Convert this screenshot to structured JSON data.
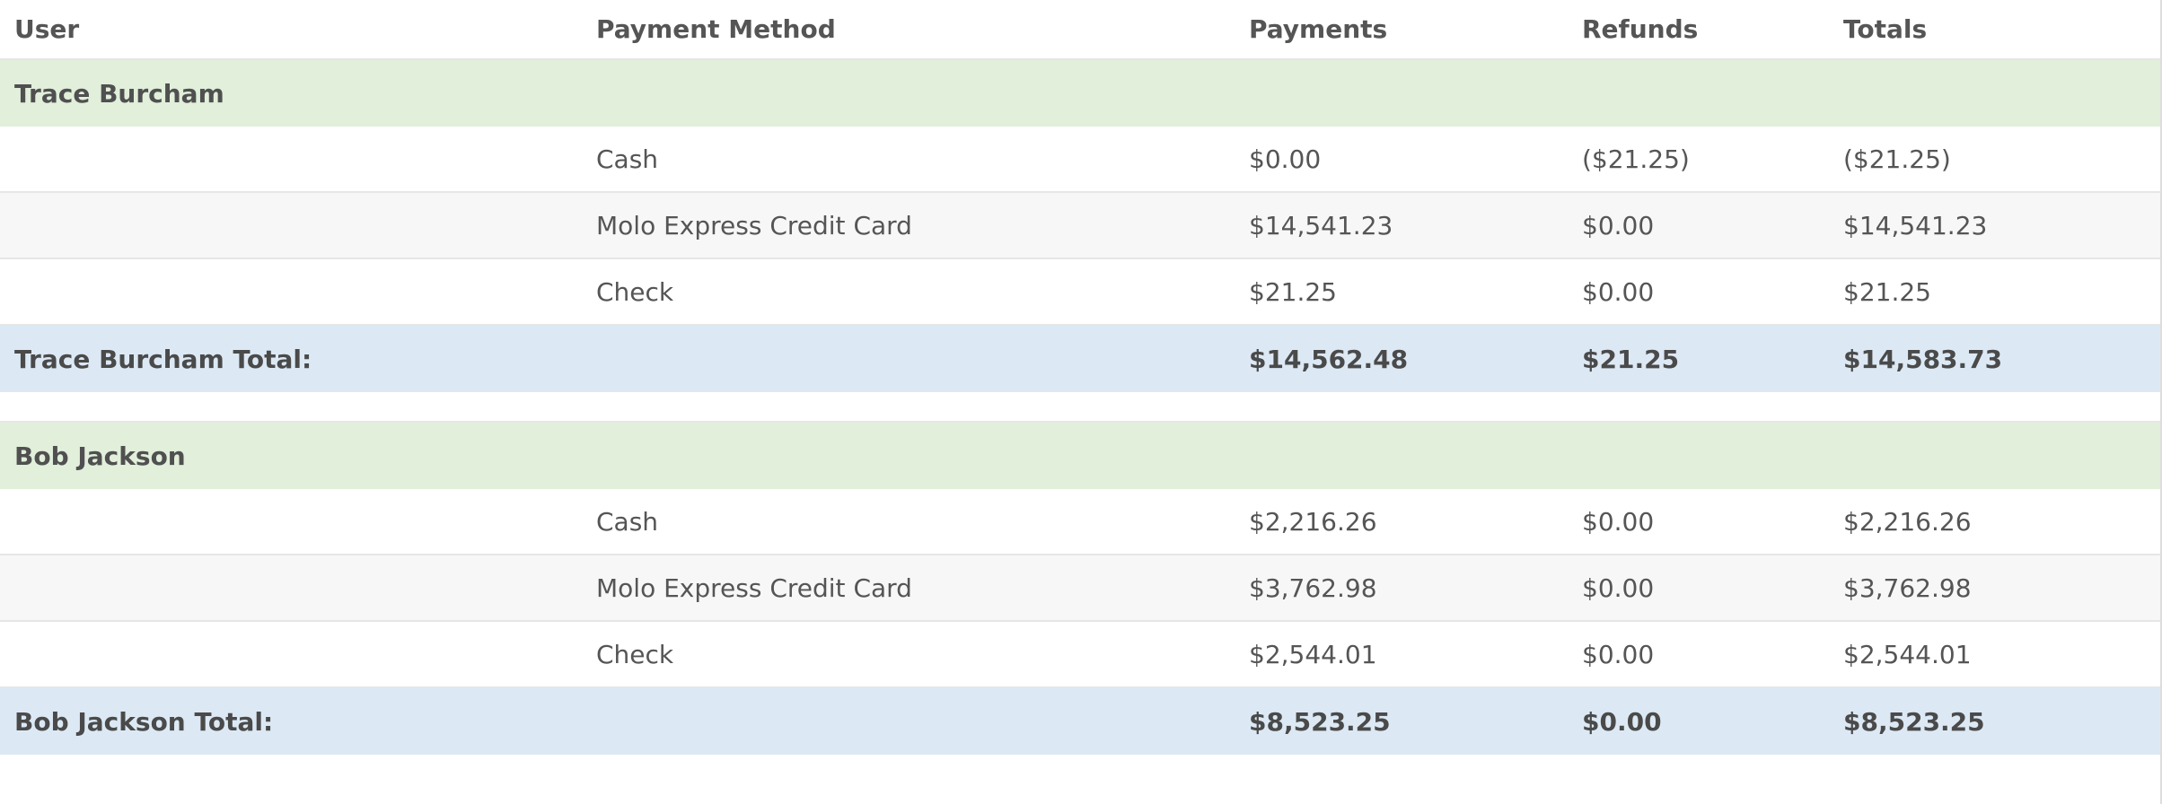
{
  "table": {
    "headers": {
      "user": "User",
      "payment_method": "Payment Method",
      "payments": "Payments",
      "refunds": "Refunds",
      "totals": "Totals"
    },
    "groups": [
      {
        "user": "Trace Burcham",
        "rows": [
          {
            "method": "Cash",
            "payments": "$0.00",
            "refunds": "($21.25)",
            "totals": "($21.25)"
          },
          {
            "method": "Molo Express Credit Card",
            "payments": "$14,541.23",
            "refunds": "$0.00",
            "totals": "$14,541.23"
          },
          {
            "method": "Check",
            "payments": "$21.25",
            "refunds": "$0.00",
            "totals": "$21.25"
          }
        ],
        "total": {
          "label": "Trace Burcham Total:",
          "payments": "$14,562.48",
          "refunds": "$21.25",
          "totals": "$14,583.73"
        }
      },
      {
        "user": "Bob Jackson",
        "rows": [
          {
            "method": "Cash",
            "payments": "$2,216.26",
            "refunds": "$0.00",
            "totals": "$2,216.26"
          },
          {
            "method": "Molo Express Credit Card",
            "payments": "$3,762.98",
            "refunds": "$0.00",
            "totals": "$3,762.98"
          },
          {
            "method": "Check",
            "payments": "$2,544.01",
            "refunds": "$0.00",
            "totals": "$2,544.01"
          }
        ],
        "total": {
          "label": "Bob Jackson Total:",
          "payments": "$8,523.25",
          "refunds": "$0.00",
          "totals": "$8,523.25"
        }
      }
    ]
  }
}
